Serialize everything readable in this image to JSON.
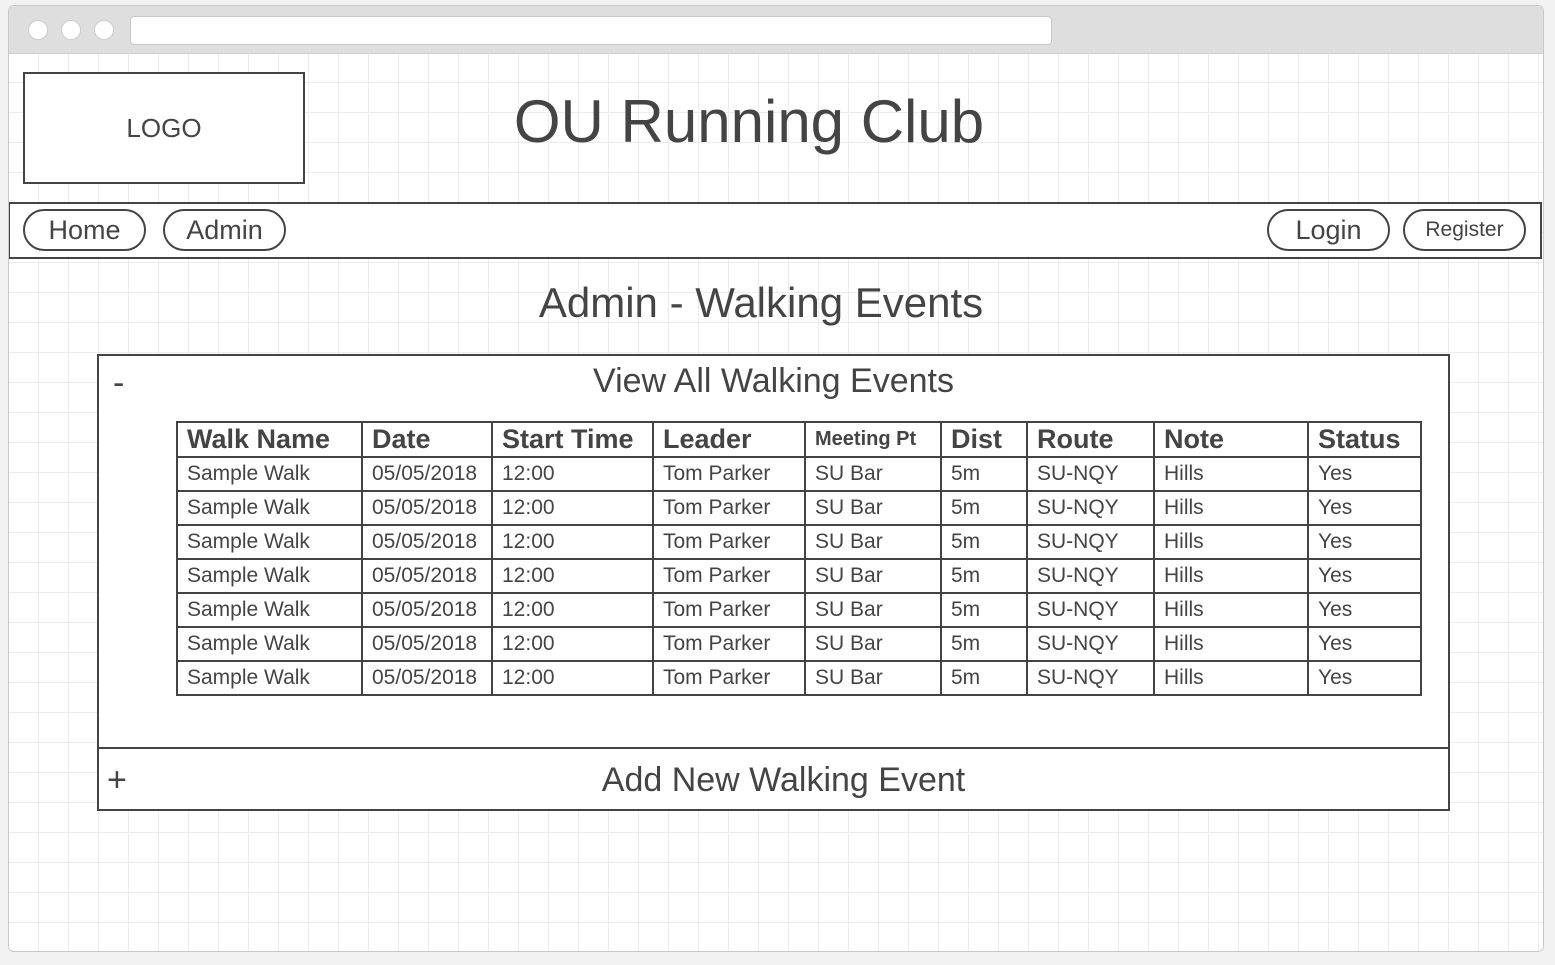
{
  "header": {
    "logo_text": "LOGO",
    "site_title": "OU Running Club"
  },
  "nav": {
    "left": [
      {
        "label": "Home"
      },
      {
        "label": "Admin"
      }
    ],
    "right": [
      {
        "label": "Login"
      },
      {
        "label": "Register"
      }
    ]
  },
  "page": {
    "heading": "Admin - Walking Events"
  },
  "accordion": {
    "view": {
      "toggle": "-",
      "title": "View All Walking Events"
    },
    "add": {
      "toggle": "+",
      "title": "Add New Walking Event"
    }
  },
  "table": {
    "columns": [
      "Walk Name",
      "Date",
      "Start Time",
      "Leader",
      "Meeting Pt",
      "Dist",
      "Route",
      "Note",
      "Status"
    ],
    "rows": [
      [
        "Sample Walk",
        "05/05/2018",
        "12:00",
        "Tom Parker",
        "SU Bar",
        "5m",
        "SU-NQY",
        "Hills",
        "Yes"
      ],
      [
        "Sample Walk",
        "05/05/2018",
        "12:00",
        "Tom Parker",
        "SU Bar",
        "5m",
        "SU-NQY",
        "Hills",
        "Yes"
      ],
      [
        "Sample Walk",
        "05/05/2018",
        "12:00",
        "Tom Parker",
        "SU Bar",
        "5m",
        "SU-NQY",
        "Hills",
        "Yes"
      ],
      [
        "Sample Walk",
        "05/05/2018",
        "12:00",
        "Tom Parker",
        "SU Bar",
        "5m",
        "SU-NQY",
        "Hills",
        "Yes"
      ],
      [
        "Sample Walk",
        "05/05/2018",
        "12:00",
        "Tom Parker",
        "SU Bar",
        "5m",
        "SU-NQY",
        "Hills",
        "Yes"
      ],
      [
        "Sample Walk",
        "05/05/2018",
        "12:00",
        "Tom Parker",
        "SU Bar",
        "5m",
        "SU-NQY",
        "Hills",
        "Yes"
      ],
      [
        "Sample Walk",
        "05/05/2018",
        "12:00",
        "Tom Parker",
        "SU Bar",
        "5m",
        "SU-NQY",
        "Hills",
        "Yes"
      ]
    ]
  }
}
